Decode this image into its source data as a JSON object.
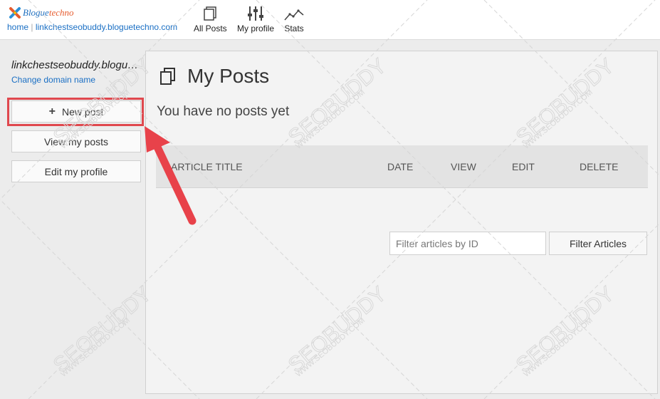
{
  "header": {
    "logo_text_a": "Blogue",
    "logo_text_b": "techno",
    "home_link": "home",
    "separator": "|",
    "domain_link": "linkchestseobuddy.bloguetechno.com",
    "nav": [
      {
        "label": "All Posts",
        "icon": "posts-icon"
      },
      {
        "label": "My profile",
        "icon": "sliders-icon"
      },
      {
        "label": "Stats",
        "icon": "stats-icon"
      }
    ]
  },
  "sidebar": {
    "site_title": "linkchestseobuddy.bloguetechno.com",
    "change_domain": "Change domain name",
    "buttons": [
      {
        "label": "New post",
        "icon": "plus-icon"
      },
      {
        "label": "View my posts"
      },
      {
        "label": "Edit my profile"
      }
    ]
  },
  "main": {
    "title": "My Posts",
    "empty_message": "You have no posts yet",
    "columns": [
      "ARTICLE TITLE",
      "DATE",
      "VIEW",
      "EDIT",
      "DELETE"
    ],
    "filter": {
      "placeholder": "Filter articles by ID",
      "button_label": "Filter Articles"
    }
  },
  "watermark": {
    "brand": "SEOBUDDY",
    "url": "WWW.SEOBUDDY.COM"
  },
  "colors": {
    "link": "#1a6fc4",
    "highlight": "#e0484e",
    "arrow": "#e8424a"
  }
}
